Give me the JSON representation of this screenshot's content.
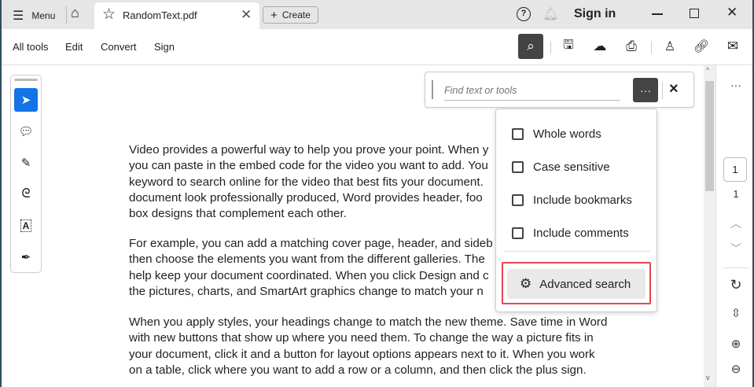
{
  "titlebar": {
    "menu_label": "Menu",
    "tab_title": "RandomText.pdf",
    "create_label": "Create",
    "sign_in": "Sign in"
  },
  "toolbar": {
    "menus": [
      "All tools",
      "Edit",
      "Convert",
      "Sign"
    ]
  },
  "search": {
    "placeholder": "Find text or tools",
    "more_label": "···",
    "close_label": "×"
  },
  "search_options": {
    "options": [
      {
        "label": "Whole words",
        "checked": false
      },
      {
        "label": "Case sensitive",
        "checked": false
      },
      {
        "label": "Include bookmarks",
        "checked": false
      },
      {
        "label": "Include comments",
        "checked": false
      }
    ],
    "advanced_label": "Advanced search"
  },
  "document": {
    "paragraphs": [
      [
        "Video provides a powerful way to help you prove your point. When y",
        "you can paste in the embed code for the video you want to add. You",
        "keyword to search online for the video that best fits your document.",
        "document look professionally produced, Word provides header, foo",
        "box designs that complement each other."
      ],
      [
        "For example, you can add a matching cover page, header, and sideb",
        "then choose the elements you want from the different galleries. The",
        "help keep your document coordinated. When you click Design and c",
        "the pictures, charts, and SmartArt graphics change to match your n"
      ],
      [
        "When you apply styles, your headings change to match the new theme. Save time in Word",
        "with new buttons that show up where you need them. To change the way a picture fits in",
        "your document, click it and a button for layout options appears next to it. When you work",
        "on a table, click where you want to add a row or a column, and then click the plus sign."
      ]
    ]
  },
  "pagination": {
    "current_page": "1",
    "total_pages": "1"
  },
  "colors": {
    "accent": "#1473e6",
    "highlight": "#e34850"
  }
}
